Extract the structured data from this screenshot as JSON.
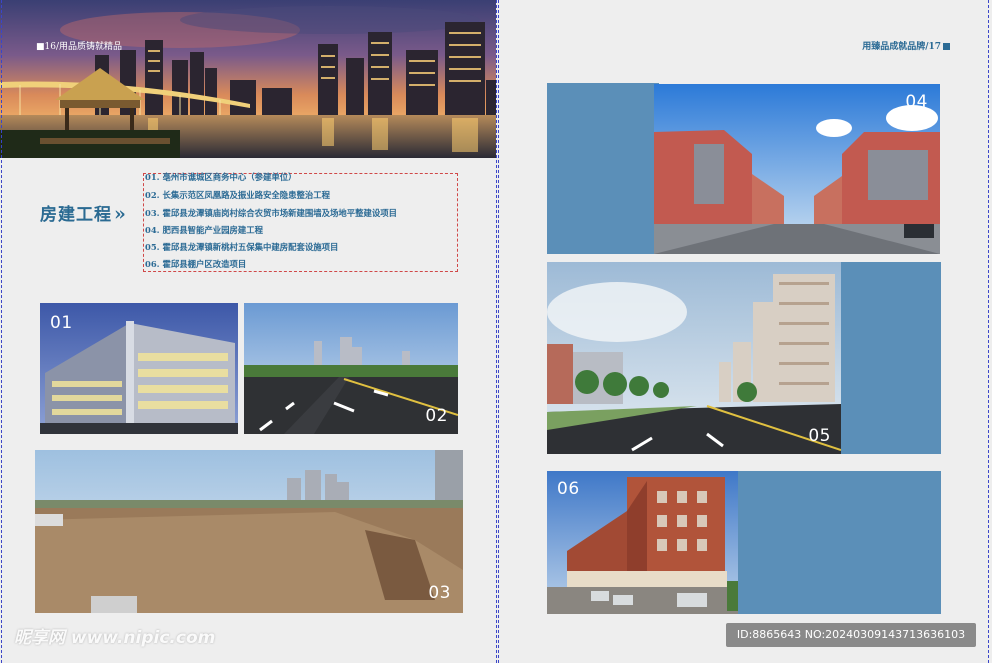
{
  "header": {
    "left_text": "■16/用品质铸就精品",
    "right_text": "用臻品成就品牌/17"
  },
  "section": {
    "title": "房建工程",
    "arrows": "»"
  },
  "projects": [
    "01. 亳州市谯城区商务中心（参建单位）",
    "02. 长集示范区凤凰路及振业路安全隐患整治工程",
    "03. 霍邱县龙潭镇庙岗村综合农贸市场新建围墙及场地平整建设项目",
    "04. 肥西县智能产业园房建工程",
    "05. 霍邱县龙潭镇新桃村五保集中建房配套设施项目",
    "06. 霍邱县棚户区改造项目"
  ],
  "photo_numbers": {
    "p01": "01",
    "p02": "02",
    "p03": "03",
    "p04": "04",
    "p05": "05",
    "p06": "06"
  },
  "watermark": "昵享网 www.nipic.com",
  "image_id": "ID:8865643 NO:20240309143713636103",
  "colors": {
    "accent_blue": "#5b8fb8",
    "title_blue": "#2a6a92",
    "guide_line": "#3b46c8",
    "dashed_box": "#d04848"
  }
}
